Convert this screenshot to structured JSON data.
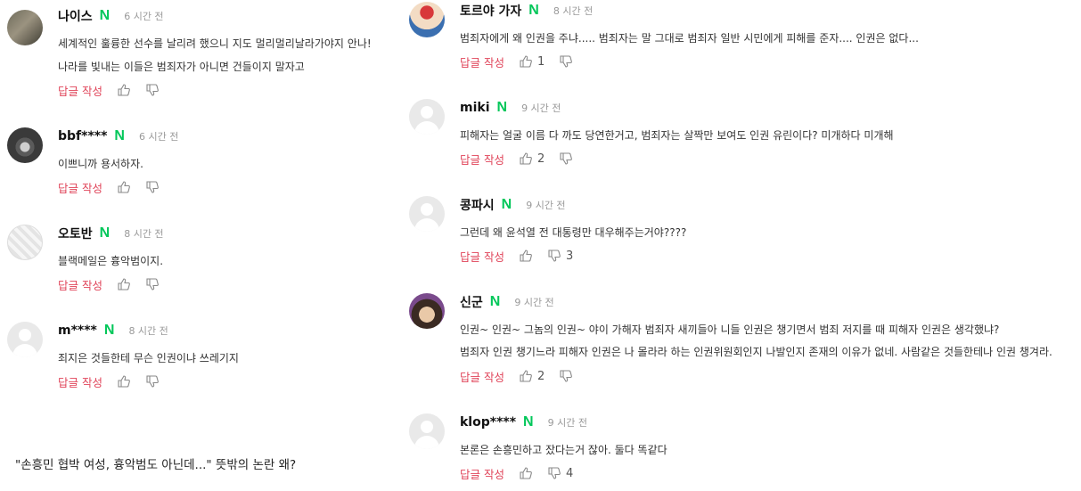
{
  "left": [
    {
      "nick": "나이스",
      "time": "6 시간 전",
      "lines": [
        "세계적인 훌륭한 선수를 날리려 했으니 지도 멀리멀리날라가야지 안나!",
        "나라를 빛내는 이들은 범죄자가 아니면 건들이지 말자고"
      ],
      "reply": "답글 작성",
      "like_count": "",
      "avatar": "photo-avatar"
    },
    {
      "nick": "bbf****",
      "time": "6 시간 전",
      "lines": [
        "이쁘니까 용서하자."
      ],
      "reply": "답글 작성",
      "like_count": "",
      "avatar": "cat-avatar"
    },
    {
      "nick": "오토반",
      "time": "8 시간 전",
      "lines": [
        "블랙메일은 흉악범이지."
      ],
      "reply": "답글 작성",
      "like_count": "",
      "avatar": "pattern-avatar"
    },
    {
      "nick": "m****",
      "time": "8 시간 전",
      "lines": [
        "죄지은 것들한테 무슨 인권이냐 쓰레기지"
      ],
      "reply": "답글 작성",
      "like_count": "",
      "avatar": "default-avatar"
    }
  ],
  "right": [
    {
      "nick": "토르야 가자",
      "time": "8 시간 전",
      "lines": [
        "범죄자에게 왜 인권을 주냐..... 범죄자는 말 그대로 범죄자 일반 시민에게 피해를 준자.... 인권은 없다..."
      ],
      "reply": "답글 작성",
      "like_count": "1",
      "dislike_count": "",
      "avatar": "character-avatar"
    },
    {
      "nick": "miki",
      "time": "9 시간 전",
      "lines": [
        "피해자는 얼굴 이름 다 까도 당연한거고, 범죄자는 살짝만 보여도 인권 유린이다? 미개하다 미개해"
      ],
      "reply": "답글 작성",
      "like_count": "2",
      "dislike_count": "",
      "avatar": "default-avatar"
    },
    {
      "nick": "콩파시",
      "time": "9 시간 전",
      "lines": [
        "그런데 왜 윤석열 전 대통령만 대우해주는거야????"
      ],
      "reply": "답글 작성",
      "like_count": "",
      "dislike_count": "3",
      "avatar": "default-avatar"
    },
    {
      "nick": "신군",
      "time": "9 시간 전",
      "lines": [
        "인권~ 인권~ 그놈의 인권~ 야이 가해자 범죄자 새끼들아 니들 인권은 챙기면서 범죄 저지를 때 피해자 인권은 생각했냐?",
        "범죄자 인권 챙기느라 피해자 인권은 나 몰라라 하는 인권위원회인지 나발인지 존재의 이유가 없네. 사람같은 것들한테나 인권 챙겨라."
      ],
      "reply": "답글 작성",
      "like_count": "2",
      "dislike_count": "",
      "avatar": "character-avatar"
    },
    {
      "nick": "klop****",
      "time": "9 시간 전",
      "lines": [
        "본론은 손흥민하고 잤다는거 잖아. 둘다 똑같다"
      ],
      "reply": "답글 작성",
      "like_count": "",
      "dislike_count": "4",
      "avatar": "default-avatar"
    }
  ],
  "badge": "N",
  "link_title": "\"손흥민 협박 여성, 흉악범도 아닌데...\" 뜻밖의 논란 왜?"
}
